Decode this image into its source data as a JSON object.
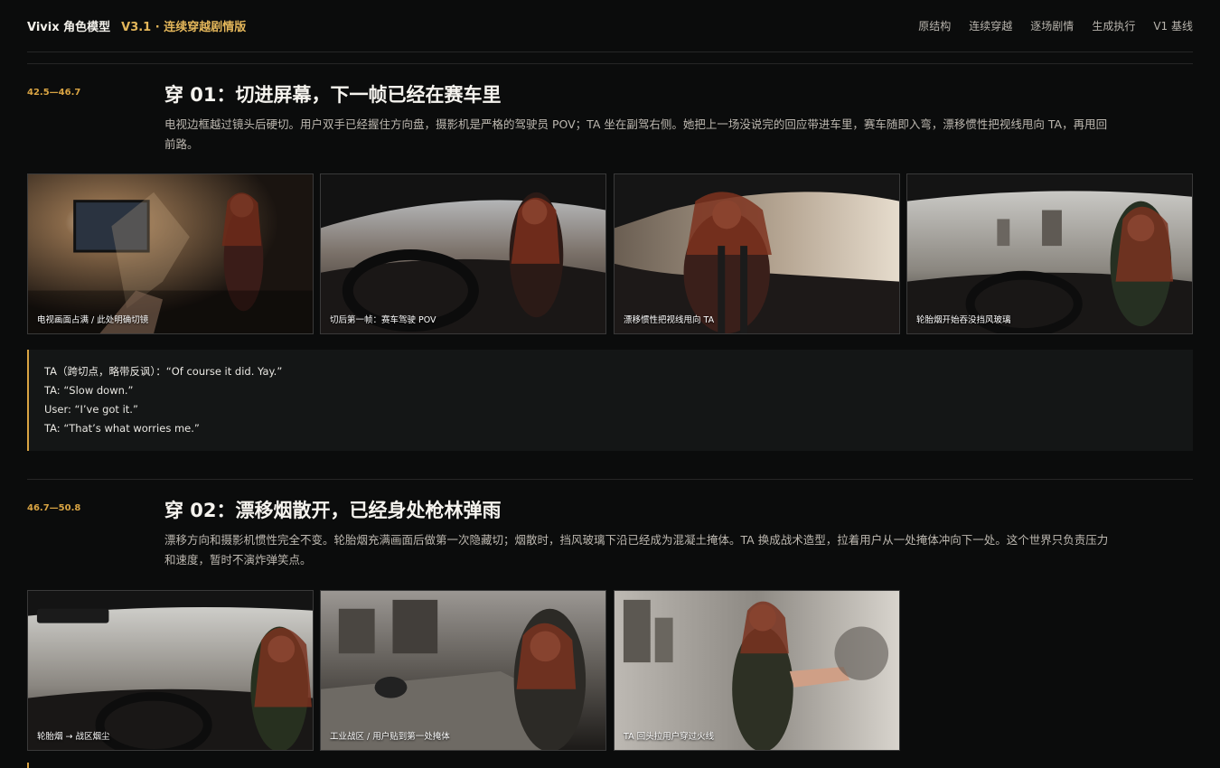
{
  "header": {
    "brand": "Vivix 角色模型",
    "version": "V3.1 · 连续穿越剧情版",
    "nav": [
      "原结构",
      "连续穿越",
      "逐场剧情",
      "生成执行",
      "V1 基线"
    ]
  },
  "sections": [
    {
      "time": "42.5—46.7",
      "title": "穿 01：切进屏幕，下一帧已经在赛车里",
      "desc": "电视边框越过镜头后硬切。用户双手已经握住方向盘，摄影机是严格的驾驶员 POV；TA 坐在副驾右侧。她把上一场没说完的回应带进车里，赛车随即入弯，漂移惯性把视线甩向 TA，再甩回前路。",
      "frames": [
        {
          "caption": "电视画面占满 / 此处明确切镜"
        },
        {
          "caption": "切后第一帧：赛车驾驶 POV"
        },
        {
          "caption": "漂移惯性把视线甩向 TA"
        },
        {
          "caption": "轮胎烟开始吞没挡风玻璃"
        }
      ],
      "dialogue": [
        "TA（跨切点，略带反讽）：“Of course it did. Yay.”",
        "TA: “Slow down.”",
        "User: “I’ve got it.”",
        "TA: “That’s what worries me.”"
      ]
    },
    {
      "time": "46.7—50.8",
      "title": "穿 02：漂移烟散开，已经身处枪林弹雨",
      "desc": "漂移方向和摄影机惯性完全不变。轮胎烟充满画面后做第一次隐藏切；烟散时，挡风玻璃下沿已经成为混凝土掩体。TA 换成战术造型，拉着用户从一处掩体冲向下一处。这个世界只负责压力和速度，暂时不演炸弹笑点。",
      "frames": [
        {
          "caption": "轮胎烟 → 战区烟尘"
        },
        {
          "caption": "工业战区 / 用户贴到第一处掩体"
        },
        {
          "caption": "TA 回头拉用户穿过火线"
        }
      ]
    }
  ]
}
